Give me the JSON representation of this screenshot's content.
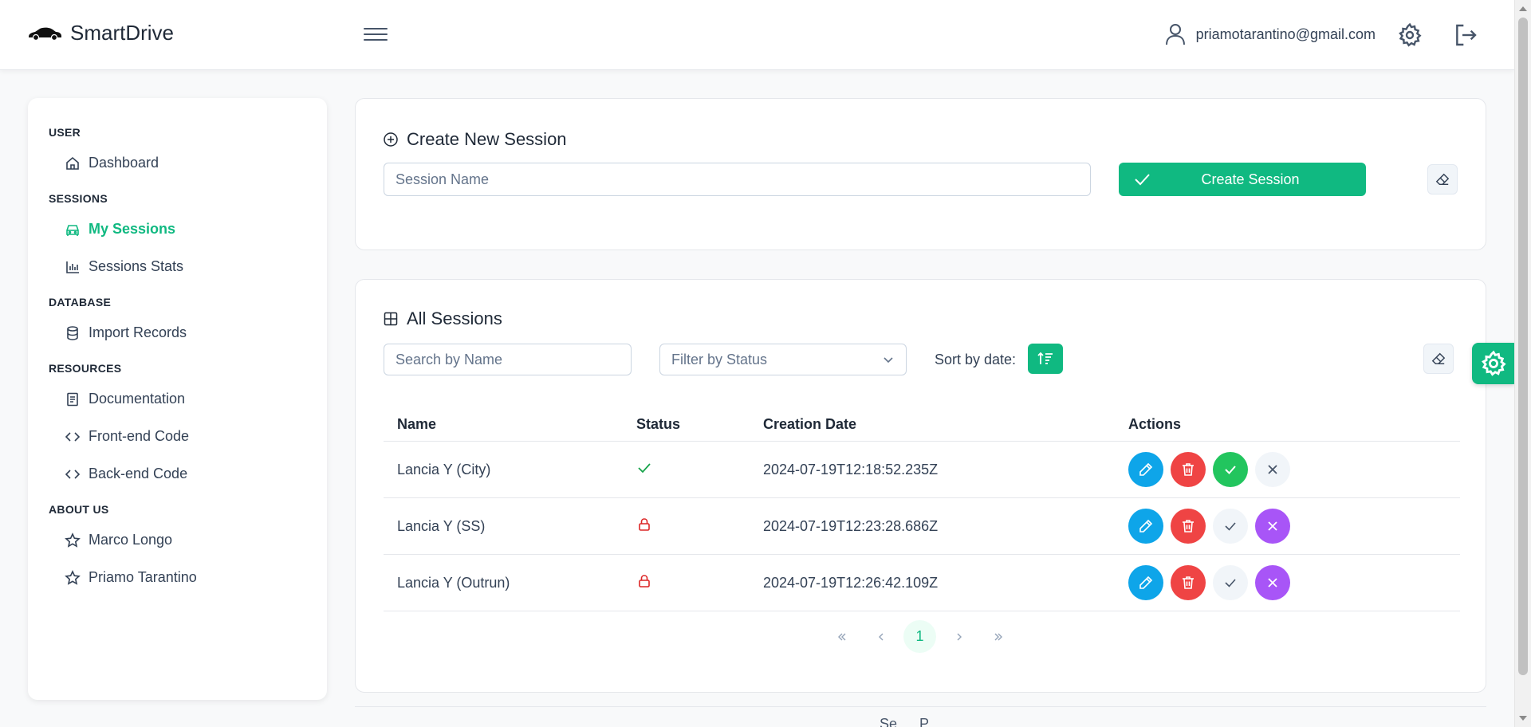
{
  "app": {
    "name": "SmartDrive"
  },
  "header": {
    "user_email": "priamotarantino@gmail.com"
  },
  "sidebar": {
    "sections": [
      {
        "title": "USER",
        "items": [
          {
            "label": "Dashboard",
            "icon": "home-icon"
          }
        ]
      },
      {
        "title": "SESSIONS",
        "items": [
          {
            "label": "My Sessions",
            "icon": "car-icon",
            "active": true
          },
          {
            "label": "Sessions Stats",
            "icon": "bar-chart-icon"
          }
        ]
      },
      {
        "title": "DATABASE",
        "items": [
          {
            "label": "Import Records",
            "icon": "database-icon"
          }
        ]
      },
      {
        "title": "RESOURCES",
        "items": [
          {
            "label": "Documentation",
            "icon": "document-icon"
          },
          {
            "label": "Front-end Code",
            "icon": "code-icon"
          },
          {
            "label": "Back-end Code",
            "icon": "code-icon"
          }
        ]
      },
      {
        "title": "ABOUT US",
        "items": [
          {
            "label": "Marco Longo",
            "icon": "star-icon"
          },
          {
            "label": "Priamo Tarantino",
            "icon": "star-icon"
          }
        ]
      }
    ]
  },
  "create": {
    "title": "Create New Session",
    "input_placeholder": "Session Name",
    "input_value": "",
    "button_label": "Create Session"
  },
  "sessions": {
    "title": "All Sessions",
    "search_placeholder": "Search by Name",
    "filter_placeholder": "Filter by Status",
    "sort_label": "Sort by date:",
    "columns": [
      "Name",
      "Status",
      "Creation Date",
      "Actions"
    ],
    "rows": [
      {
        "name": "Lancia Y (City)",
        "status": "completed",
        "status_icon": "check-icon",
        "date": "2024-07-19T12:18:52.235Z"
      },
      {
        "name": "Lancia Y (SS)",
        "status": "locked",
        "status_icon": "lock-icon",
        "date": "2024-07-19T12:23:28.686Z"
      },
      {
        "name": "Lancia Y (Outrun)",
        "status": "locked",
        "status_icon": "lock-icon",
        "date": "2024-07-19T12:26:42.109Z"
      }
    ],
    "pagination": {
      "current_page": "1"
    }
  },
  "footer": {
    "text": "… Se … P…"
  },
  "colors": {
    "accent": "#10b981",
    "edit": "#0ea5e9",
    "delete": "#ef4444",
    "complete": "#22c55e",
    "cancel": "#a855f7",
    "lock": "#dc2626"
  }
}
